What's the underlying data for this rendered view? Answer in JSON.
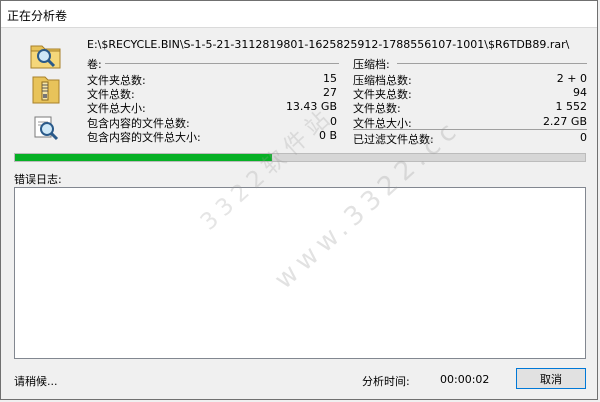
{
  "window": {
    "title": "正在分析卷",
    "path": "E:\\$RECYCLE.BIN\\S-1-5-21-3112819801-1625825912-1788556107-1001\\$R6TDB89.rar\\"
  },
  "icons": [
    "folder-search-icon",
    "archive-icon",
    "filter-search-icon"
  ],
  "volume": {
    "header": "卷:",
    "rows": [
      {
        "label": "文件夹总数:",
        "value": "15"
      },
      {
        "label": "文件总数:",
        "value": "27"
      },
      {
        "label": "文件总大小:",
        "value": "13.43 GB"
      },
      {
        "label": "包含内容的文件总数:",
        "value": "0"
      },
      {
        "label": "包含内容的文件总大小:",
        "value": "0 B"
      }
    ]
  },
  "archive": {
    "header": "压缩档:",
    "rows": [
      {
        "label": "压缩档总数:",
        "value": "2 + 0"
      },
      {
        "label": "文件夹总数:",
        "value": "94"
      },
      {
        "label": "文件总数:",
        "value": "1 552"
      },
      {
        "label": "文件总大小:",
        "value": "2.27 GB"
      }
    ],
    "filtered_label": "已过滤文件总数:",
    "filtered_value": "0"
  },
  "progress": {
    "fraction": 0.45,
    "color": "#06b025"
  },
  "log": {
    "label": "错误日志:"
  },
  "footer": {
    "status": "请稍候...",
    "time_label": "分析时间:",
    "time_value": "00:00:02",
    "cancel_label": "取消"
  },
  "watermark": {
    "line1": "3322软件站",
    "line2": "www.3322.cc"
  }
}
